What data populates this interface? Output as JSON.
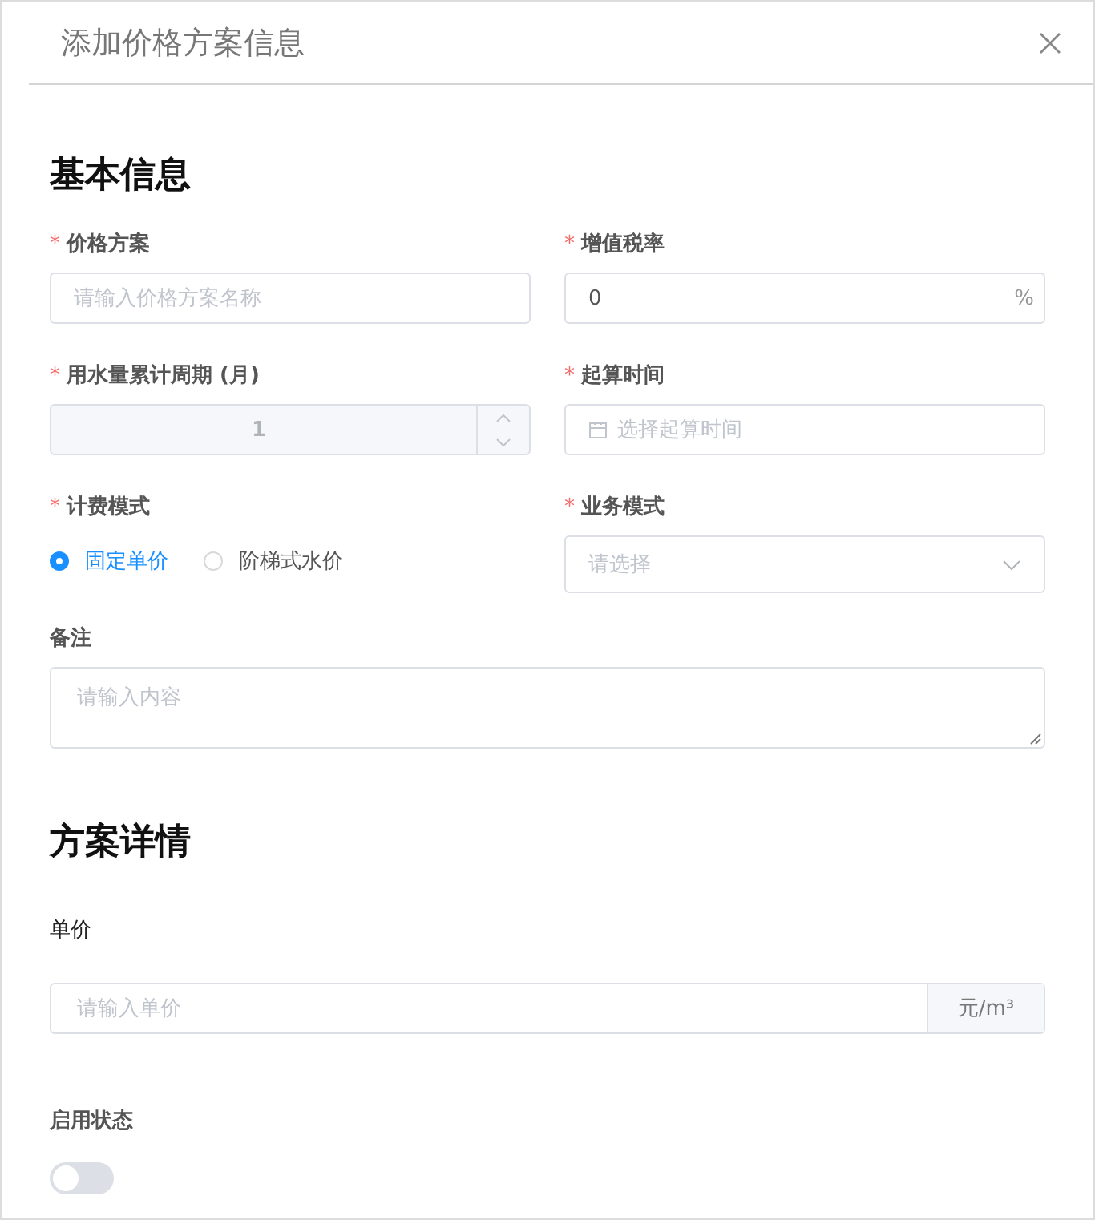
{
  "dialog": {
    "title": "添加价格方案信息"
  },
  "basic": {
    "title": "基本信息",
    "fields": [
      {
        "kind": "text",
        "required_mark": "*",
        "label": "价格方案",
        "placeholder": "请输入价格方案名称"
      },
      {
        "kind": "text",
        "required_mark": "*",
        "label": "增值税率",
        "value": "0",
        "suffix": "%"
      },
      {
        "kind": "number",
        "required_mark": "*",
        "label": "用水量累计周期 (月)",
        "value": "1",
        "disabled": true
      },
      {
        "kind": "date",
        "required_mark": "*",
        "label": "起算时间",
        "placeholder": "选择起算时间"
      },
      {
        "kind": "radio",
        "required_mark": "*",
        "label": "计费模式",
        "options": [
          {
            "label": "固定单价",
            "selected": true
          },
          {
            "label": "阶梯式水价",
            "selected": false
          }
        ]
      },
      {
        "kind": "select",
        "required_mark": "*",
        "label": "业务模式",
        "placeholder": "请选择"
      },
      {
        "kind": "textarea",
        "label": "备注",
        "placeholder": "请输入内容"
      }
    ]
  },
  "details": {
    "title": "方案详情",
    "price": {
      "label": "单价",
      "placeholder": "请输入单价",
      "append": "元/m³"
    },
    "status": {
      "label": "启用状态",
      "on": false
    }
  }
}
